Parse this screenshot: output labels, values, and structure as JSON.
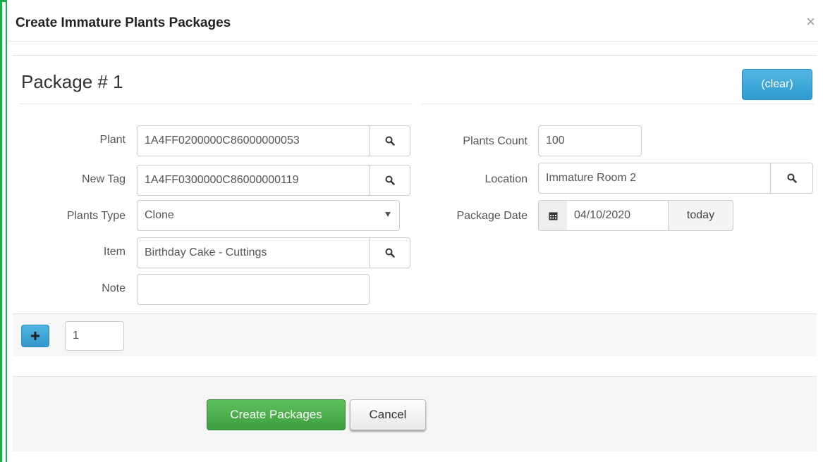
{
  "dialog": {
    "title": "Create Immature Plants Packages",
    "close_label": "×"
  },
  "package": {
    "title": "Package # 1",
    "clear_label": "(clear)"
  },
  "left_form": {
    "plant": {
      "label": "Plant",
      "value": "1A4FF0200000C86000000053"
    },
    "new_tag": {
      "label": "New Tag",
      "value": "1A4FF0300000C86000000119"
    },
    "plants_type": {
      "label": "Plants Type",
      "value": "Clone"
    },
    "item": {
      "label": "Item",
      "value": "Birthday Cake - Cuttings"
    },
    "note": {
      "label": "Note",
      "value": ""
    }
  },
  "right_form": {
    "plants_count": {
      "label": "Plants Count",
      "value": "100"
    },
    "location": {
      "label": "Location",
      "value": "Immature Room 2"
    },
    "package_date": {
      "label": "Package Date",
      "value": "04/10/2020",
      "today_label": "today"
    }
  },
  "add_row": {
    "count_value": "1"
  },
  "footer": {
    "create_label": "Create Packages",
    "cancel_label": "Cancel"
  },
  "icons": {
    "search": "search-icon",
    "calendar": "calendar-icon",
    "plus": "plus-icon",
    "dropdown": "chevron-down-icon"
  },
  "colors": {
    "frame_border": "#1faa4b",
    "primary_blue": "#3fa8d8",
    "success_green": "#4cae4c"
  }
}
